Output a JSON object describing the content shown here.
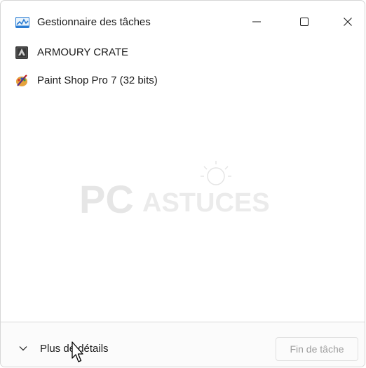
{
  "window": {
    "title": "Gestionnaire des tâches",
    "app_icon": "task-manager-icon",
    "controls": [
      "minimize-icon",
      "maximize-icon",
      "close-icon"
    ]
  },
  "apps": [
    {
      "label": "ARMOURY CRATE",
      "icon": "armoury-crate-icon"
    },
    {
      "label": "Paint Shop Pro 7 (32 bits)",
      "icon": "paint-shop-pro-icon"
    }
  ],
  "watermark": {
    "text_pc": "PC",
    "text_rest": "ASTUCES"
  },
  "footer": {
    "details_label": "Plus de détails",
    "end_task_label": "Fin de tâche",
    "end_task_enabled": false
  },
  "colors": {
    "text": "#1a1a1a",
    "disabled_text": "#9e9e9e",
    "border": "#d9d9d9",
    "watermark": "#e6e6e6"
  }
}
